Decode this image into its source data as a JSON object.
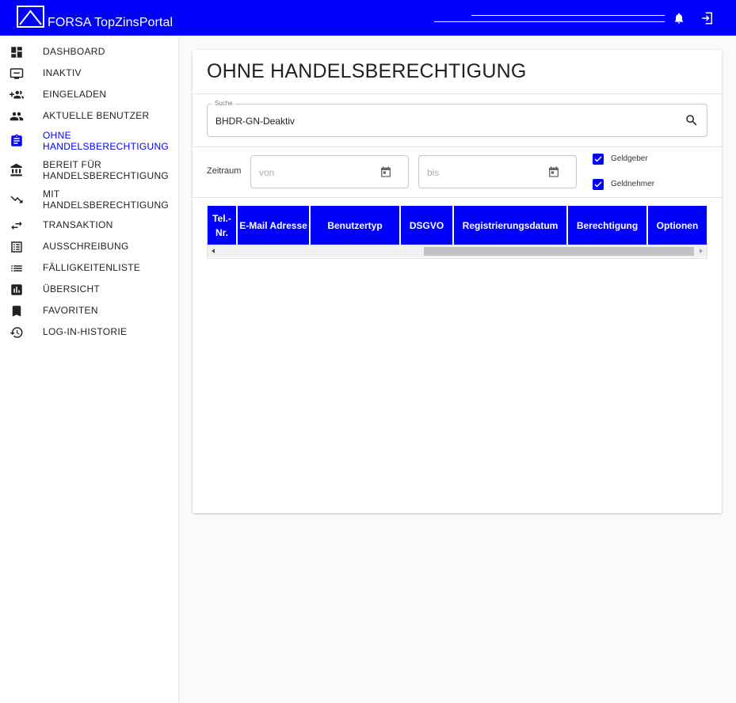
{
  "header": {
    "brand": "FORSA TopZinsPortal"
  },
  "sidebar": {
    "items": [
      {
        "label": "DASHBOARD",
        "icon": "dashboard-icon"
      },
      {
        "label": "INAKTIV",
        "icon": "monitor-icon"
      },
      {
        "label": "EINGELADEN",
        "icon": "group-add-icon"
      },
      {
        "label": "AKTUELLE BENUTZER",
        "icon": "people-icon"
      },
      {
        "label": "OHNE HANDELSBERECHTIGUNG",
        "icon": "clipboard-icon",
        "active": true
      },
      {
        "label": "BEREIT FÜR HANDELSBERECHTIGUNG",
        "icon": "bank-icon"
      },
      {
        "label": "MIT HANDELSBERECHTIGUNG",
        "icon": "trending-down-icon"
      },
      {
        "label": "TRANSAKTION",
        "icon": "swap-icon"
      },
      {
        "label": "AUSSCHREIBUNG",
        "icon": "list-alt-icon"
      },
      {
        "label": "FÄLLIGKEITENLISTE",
        "icon": "list-icon"
      },
      {
        "label": "ÜBERSICHT",
        "icon": "bar-chart-icon"
      },
      {
        "label": "FAVORITEN",
        "icon": "bookmark-icon"
      },
      {
        "label": "LOG-IN-HISTORIE",
        "icon": "history-icon"
      }
    ]
  },
  "main": {
    "title": "OHNE HANDELSBERECHTIGUNG",
    "search": {
      "label": "Suche",
      "value": "BHDR-GN-Deaktiv"
    },
    "filter": {
      "zeitraum_label": "Zeitraum",
      "from_placeholder": "von",
      "to_placeholder": "bis",
      "checkboxes": [
        {
          "label": "Geldgeber",
          "checked": true
        },
        {
          "label": "Geldnehmer",
          "checked": true
        }
      ]
    },
    "table": {
      "columns": [
        "Tel.-Nr.",
        "E-Mail Adresse",
        "Benutzertyp",
        "DSGVO",
        "Registrierungsdatum",
        "Berechtigung",
        "Optionen"
      ]
    }
  },
  "colors": {
    "primary": "#0000ff",
    "background": "#fafafa"
  }
}
